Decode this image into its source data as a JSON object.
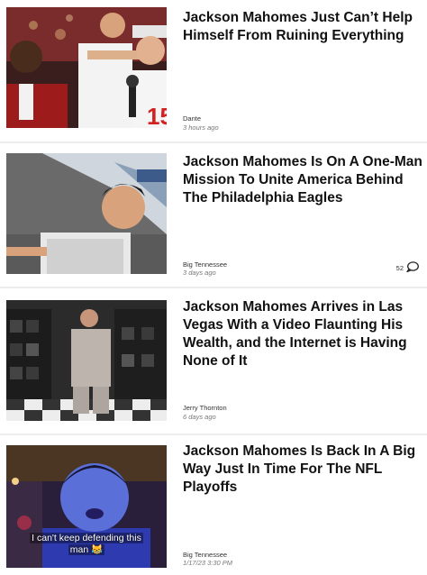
{
  "articles": [
    {
      "headline": "Jackson Mahomes Just Can’t Help Himself From Ruining Everything",
      "author": "Dante",
      "time": "3 hours ago",
      "comments": ""
    },
    {
      "headline": "Jackson Mahomes Is On A One-Man Mission To Unite America Behind The Philadelphia Eagles",
      "author": "Big Tennessee",
      "time": "3 days ago",
      "comments": "52"
    },
    {
      "headline": "Jackson Mahomes Arrives in Las Vegas With a Video Flaunting His Wealth, and the Internet is Having None of It",
      "author": "Jerry Thornton",
      "time": "6 days ago",
      "comments": ""
    },
    {
      "headline": "Jackson Mahomes Is Back In A Big Way Just In Time For The NFL Playoffs",
      "author": "Big Tennessee",
      "time": "1/17/23 3:30 PM",
      "comments": "",
      "image_caption_line1": "I can't keep defending this",
      "image_caption_line2": "man 😹"
    }
  ],
  "icons": {
    "comment": "speech-bubble-icon"
  },
  "colors": {
    "headline": "#111111",
    "meta": "#777777",
    "divider": "#ececec"
  }
}
